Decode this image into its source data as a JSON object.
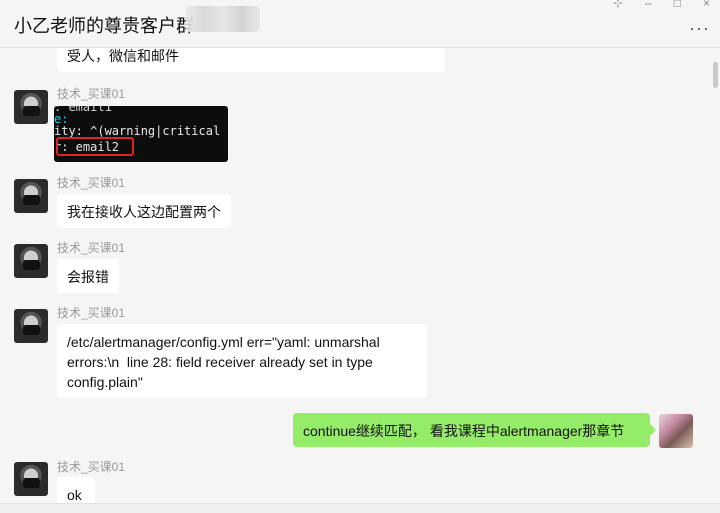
{
  "header": {
    "title": "小乙老师的尊贵客户群",
    "more_label": "···",
    "controls": {
      "pin": "⊹",
      "minimize": "–",
      "maximize": "□",
      "close": "×"
    }
  },
  "messages": [
    {
      "type": "text",
      "side": "left",
      "text": "受人，微信和邮件"
    },
    {
      "type": "image",
      "side": "left",
      "sender": "技术_买课01",
      "code_lines": [
        ": email1",
        "e:",
        "ity: ^(warning|critical",
        "r: email2"
      ]
    },
    {
      "type": "text",
      "side": "left",
      "sender": "技术_买课01",
      "text": "我在接收人这边配置两个"
    },
    {
      "type": "text",
      "side": "left",
      "sender": "技术_买课01",
      "text": "会报错"
    },
    {
      "type": "text",
      "side": "left",
      "sender": "技术_买课01",
      "lines": [
        "/etc/alertmanager/config.yml err=\"yaml: unmarshal",
        "errors:\\n  line 28: field receiver already set in type",
        "config.plain\""
      ]
    },
    {
      "type": "text",
      "side": "right",
      "text": "continue继续匹配， 看我课程中alertmanager那章节"
    },
    {
      "type": "text",
      "side": "left",
      "sender": "技术_买课01",
      "text": "ok"
    }
  ],
  "colors": {
    "my_bubble": "#95ec69",
    "their_bubble": "#ffffff",
    "highlight_box": "#e02424",
    "background": "#f5f5f5"
  }
}
